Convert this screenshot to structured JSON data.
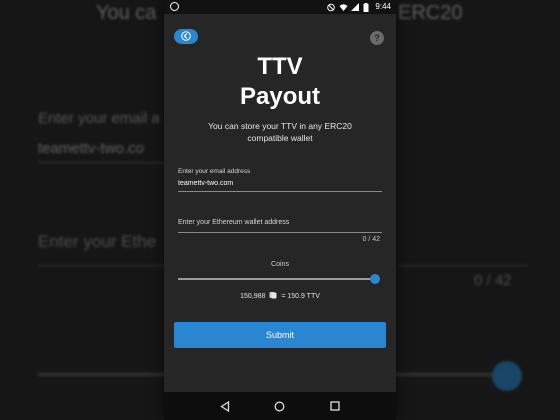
{
  "statusbar": {
    "time": "9:44"
  },
  "header": {
    "back_icon": "back-arrow-icon",
    "help_icon": "help-icon",
    "help_glyph": "?"
  },
  "title": {
    "line1": "TTV",
    "line2": "Payout"
  },
  "subtitle": {
    "line1": "You can store your TTV in any ERC20",
    "line2": "compatible wallet"
  },
  "email": {
    "label": "Enter your email address",
    "value": "teamettv-two.com"
  },
  "wallet": {
    "label": "Enter your Ethereum wallet address",
    "value": "",
    "counter": "0 / 42"
  },
  "coins": {
    "label": "Coins",
    "slider_level": 1.0,
    "value": "150,988",
    "equals": "= 150.9 TTV"
  },
  "submit": {
    "label": "Submit"
  },
  "navbar": {
    "back": "nav-back-icon",
    "home": "nav-home-icon",
    "recents": "nav-recents-icon"
  },
  "background": {
    "title_left": "You ca",
    "title_right": "ERC20",
    "email_label": "Enter your email a",
    "email_value": "teamettv-two.co",
    "wallet_label": "Enter your Ethe",
    "counter": "0 / 42"
  },
  "colors": {
    "accent": "#2a86d1",
    "screen_bg": "#262626",
    "status_bg": "#121212"
  }
}
